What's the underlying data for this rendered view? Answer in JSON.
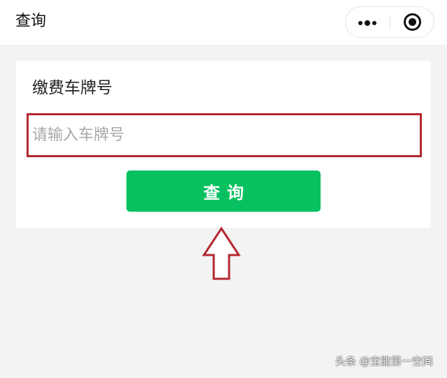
{
  "navbar": {
    "title": "查询",
    "more_icon": "more-dots-icon",
    "close_icon": "record-circle-icon"
  },
  "form": {
    "label": "缴费车牌号",
    "plate_input": {
      "value": "",
      "placeholder": "请输入车牌号"
    },
    "submit_label": "查询"
  },
  "annotation": {
    "arrow_icon": "up-arrow-icon",
    "highlight_color": "#b3282f"
  },
  "watermark": "头条 @宝能第一空间",
  "colors": {
    "button": "#07c160",
    "background": "#f3f3f3"
  }
}
